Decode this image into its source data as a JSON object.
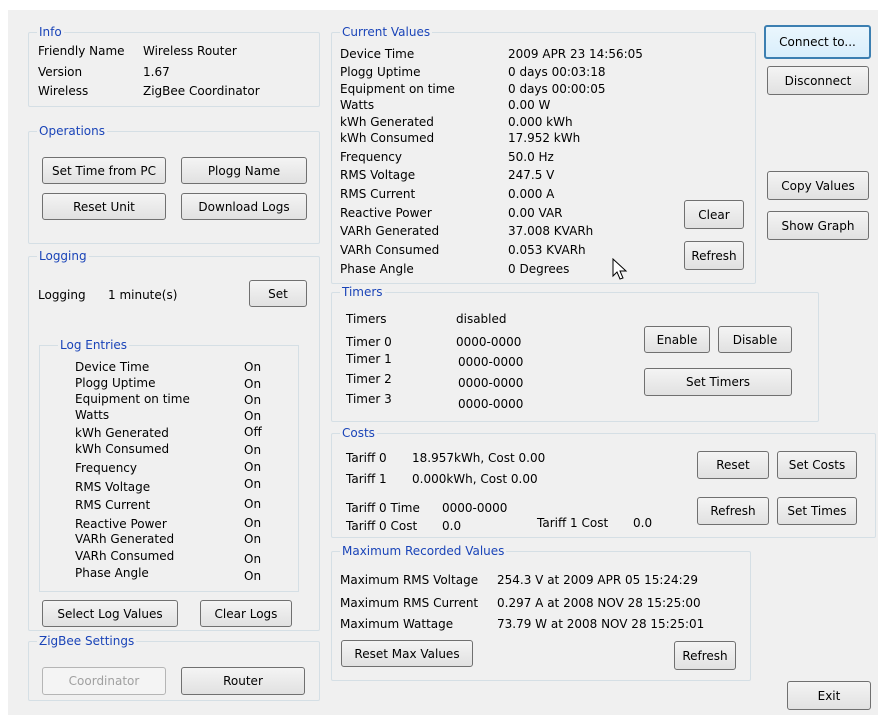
{
  "info": {
    "title": "Info",
    "rows": [
      {
        "label": "Friendly Name",
        "value": "Wireless Router"
      },
      {
        "label": "Version",
        "value": "1.67"
      },
      {
        "label": "Wireless",
        "value": "ZigBee Coordinator"
      }
    ]
  },
  "operations": {
    "title": "Operations",
    "set_time_from_pc": "Set Time from PC",
    "plogg_name": "Plogg Name",
    "reset_unit": "Reset Unit",
    "download_logs": "Download Logs"
  },
  "logging": {
    "title": "Logging",
    "label": "Logging",
    "interval": "1 minute(s)",
    "set_button": "Set",
    "entries_title": "Log Entries",
    "entries": [
      {
        "name": "Device Time",
        "state": "On"
      },
      {
        "name": "Plogg Uptime",
        "state": "On"
      },
      {
        "name": "Equipment on time",
        "state": "On"
      },
      {
        "name": "Watts",
        "state": "On"
      },
      {
        "name": "kWh Generated",
        "state": "Off"
      },
      {
        "name": "kWh Consumed",
        "state": "On"
      },
      {
        "name": "Frequency",
        "state": "On"
      },
      {
        "name": "RMS Voltage",
        "state": "On"
      },
      {
        "name": "RMS Current",
        "state": "On"
      },
      {
        "name": "Reactive Power",
        "state": "On"
      },
      {
        "name": "VARh Generated",
        "state": "On"
      },
      {
        "name": "VARh Consumed",
        "state": "On"
      },
      {
        "name": "Phase Angle",
        "state": "On"
      }
    ],
    "select_log_values": "Select Log Values",
    "clear_logs": "Clear Logs"
  },
  "zigbee": {
    "title": "ZigBee Settings",
    "coordinator": "Coordinator",
    "router": "Router"
  },
  "current": {
    "title": "Current Values",
    "rows": [
      {
        "label": "Device Time",
        "value": "2009 APR 23 14:56:05"
      },
      {
        "label": "Plogg Uptime",
        "value": "0 days 00:03:18"
      },
      {
        "label": "Equipment on time",
        "value": "0 days 00:00:05"
      },
      {
        "label": "Watts",
        "value": "0.00 W"
      },
      {
        "label": "kWh Generated",
        "value": "0.000 kWh"
      },
      {
        "label": "kWh Consumed",
        "value": "17.952 kWh"
      },
      {
        "label": "Frequency",
        "value": "50.0 Hz"
      },
      {
        "label": "RMS Voltage",
        "value": "247.5 V"
      },
      {
        "label": "RMS Current",
        "value": "0.000 A"
      },
      {
        "label": "Reactive Power",
        "value": "0.00 VAR"
      },
      {
        "label": "VARh Generated",
        "value": "37.008 KVARh"
      },
      {
        "label": "VARh Consumed",
        "value": "0.053 KVARh"
      },
      {
        "label": "Phase Angle",
        "value": "0 Degrees"
      }
    ],
    "clear": "Clear",
    "refresh": "Refresh"
  },
  "timers": {
    "title": "Timers",
    "status_label": "Timers",
    "status_value": "disabled",
    "rows": [
      {
        "label": "Timer 0",
        "value": "0000-0000"
      },
      {
        "label": "Timer 1",
        "value": "0000-0000"
      },
      {
        "label": "Timer 2",
        "value": "0000-0000"
      },
      {
        "label": "Timer 3",
        "value": "0000-0000"
      }
    ],
    "enable": "Enable",
    "disable": "Disable",
    "set_timers": "Set Timers"
  },
  "costs": {
    "title": "Costs",
    "tariff0_label": "Tariff 0",
    "tariff0_value": "18.957kWh, Cost 0.00",
    "tariff1_label": "Tariff 1",
    "tariff1_value": "0.000kWh, Cost 0.00",
    "tariff0_time_label": "Tariff 0 Time",
    "tariff0_time_value": "0000-0000",
    "tariff0_cost_label": "Tariff 0 Cost",
    "tariff0_cost_value": "0.0",
    "tariff1_cost_label": "Tariff 1 Cost",
    "tariff1_cost_value": "0.0",
    "reset": "Reset",
    "set_costs": "Set Costs",
    "refresh": "Refresh",
    "set_times": "Set Times"
  },
  "maximum": {
    "title": "Maximum Recorded Values",
    "rows": [
      {
        "label": "Maximum RMS Voltage",
        "value": "254.3 V at 2009 APR 05 15:24:29"
      },
      {
        "label": "Maximum RMS Current",
        "value": "0.297 A at 2008 NOV 28 15:25:00"
      },
      {
        "label": "Maximum Wattage",
        "value": "73.79 W at 2008 NOV 28 15:25:01"
      }
    ],
    "reset_max": "Reset Max Values",
    "refresh": "Refresh"
  },
  "side": {
    "connect": "Connect to...",
    "disconnect": "Disconnect",
    "copy_values": "Copy Values",
    "show_graph": "Show Graph",
    "exit": "Exit"
  },
  "colors": {
    "group_title": "#1a44b8",
    "panel_bg": "#f0f0f0",
    "focus_border": "#3c7fb1"
  }
}
